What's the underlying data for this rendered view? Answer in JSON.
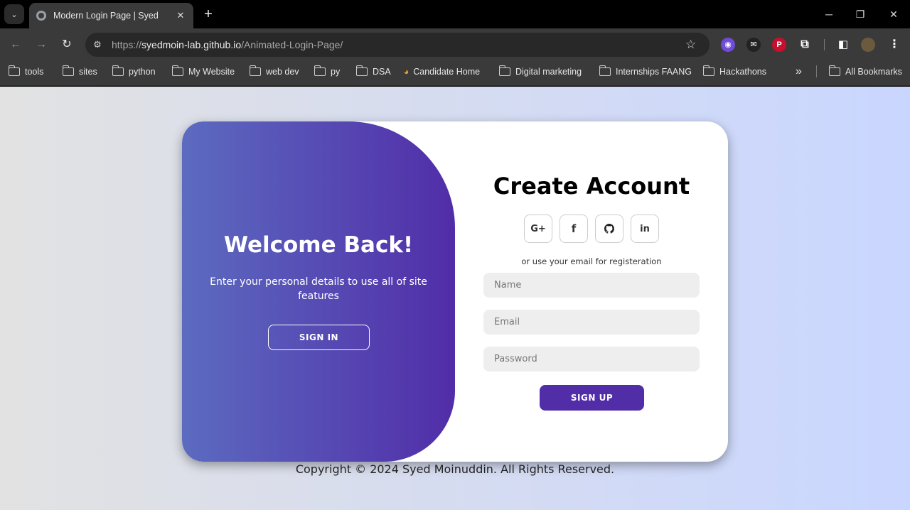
{
  "browser": {
    "tab_title": "Modern Login Page | Syed",
    "tab_close": "✕",
    "new_tab": "+",
    "url_scheme": "https://",
    "url_host": "syedmoin-lab.github.io",
    "url_path": "/Animated-Login-Page/",
    "bookmarks": [
      "tools",
      "sites",
      "python",
      "My Website",
      "web dev",
      "py",
      "DSA",
      "Candidate Home",
      "Digital marketing",
      "Internships FAANG",
      "Hackathons"
    ],
    "more_bookmarks": "»",
    "all_bookmarks": "All Bookmarks"
  },
  "welcome": {
    "title": "Welcome Back!",
    "message": "Enter your personal details to use all of site features",
    "button": "SIGN IN"
  },
  "signup": {
    "title": "Create Account",
    "socials": [
      {
        "icon": "google-plus-icon",
        "label": "G+"
      },
      {
        "icon": "facebook-icon",
        "label": "f"
      },
      {
        "icon": "github-icon",
        "label": ""
      },
      {
        "icon": "linkedin-icon",
        "label": "in"
      }
    ],
    "alt_text": "or use your email for registeration",
    "name_placeholder": "Name",
    "email_placeholder": "Email",
    "password_placeholder": "Password",
    "button": "SIGN UP"
  },
  "footer": {
    "copyright": "Copyright © 2024 Syed Moinuddin. All Rights Reserved."
  },
  "colors": {
    "accent": "#512da8",
    "gradient_start": "#5c6bc0",
    "page_gradient_end": "#c9d6ff"
  }
}
